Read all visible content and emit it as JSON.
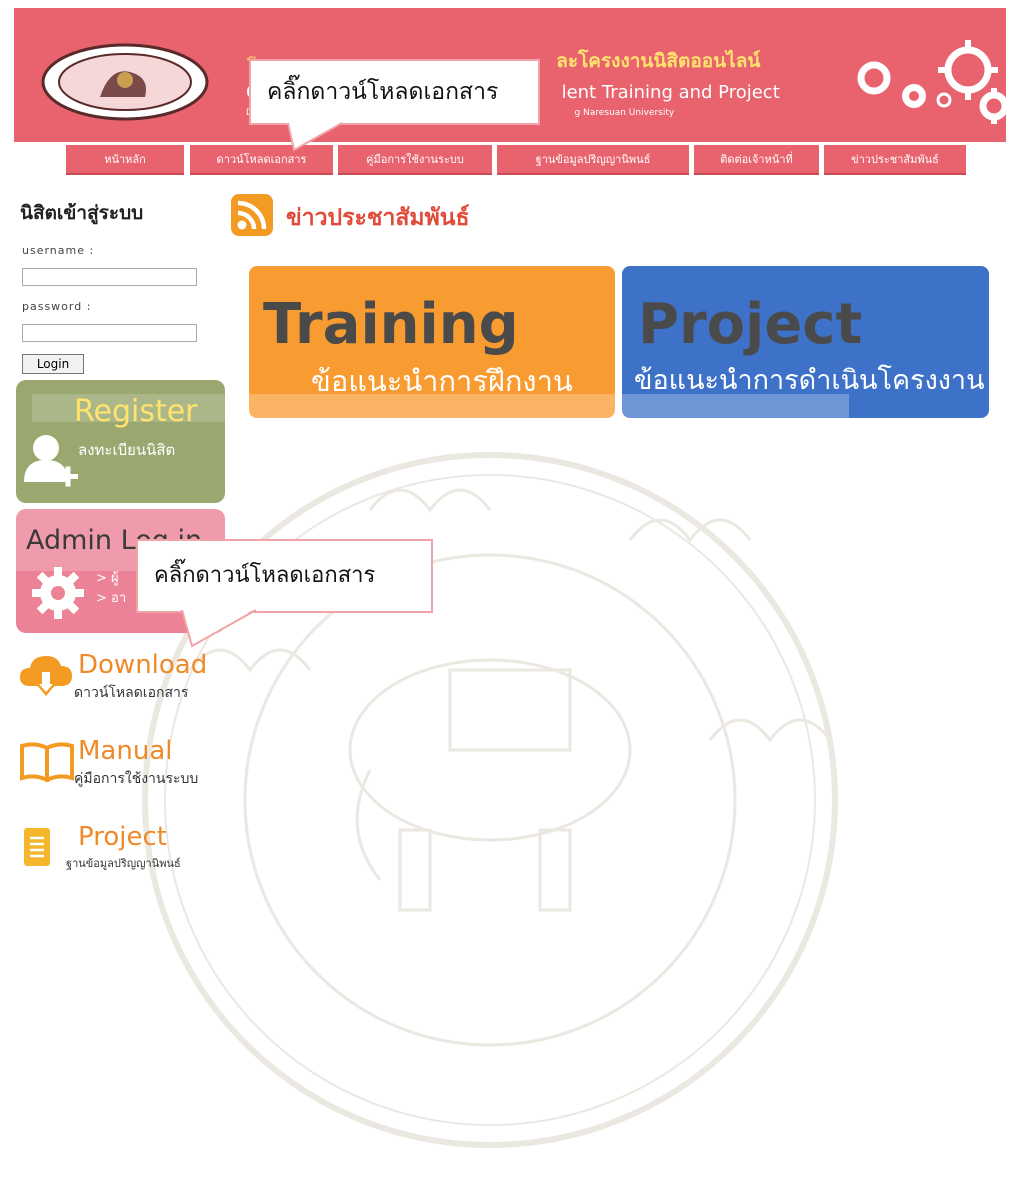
{
  "header": {
    "title_th": "ระบบฝึกงานและโครงงานนิสิตออนไลน์",
    "title_en_partial": "lent Training and Project",
    "title_sub": "g Naresuan University",
    "title_th_visible": "ละโครงงานนิสิตออนไลน์",
    "title_en_prefix": "C",
    "title_sub_prefix": "De"
  },
  "nav": {
    "items": [
      {
        "label": "หน้าหลัก"
      },
      {
        "label": "ดาวน์โหลดเอกสาร"
      },
      {
        "label": "คู่มือการใช้งานระบบ"
      },
      {
        "label": "ฐานข้อมูลปริญญานิพนธ์"
      },
      {
        "label": "ติดต่อเจ้าหน้าที่"
      },
      {
        "label": "ข่าวประชาสัมพันธ์"
      }
    ]
  },
  "callouts": {
    "top": "คลิ๊กดาวน์โหลดเอกสาร",
    "middle": "คลิ๊กดาวน์โหลดเอกสาร"
  },
  "login": {
    "title": "นิสิตเข้าสู่ระบบ",
    "username_label": "username :",
    "password_label": "password :",
    "username_value": "",
    "password_value": "",
    "button": "Login"
  },
  "register_card": {
    "title": "Register",
    "subtitle": "ลงทะเบียนนิสิต"
  },
  "admin_card": {
    "title": "Admin Log in",
    "line1": "> ผู้",
    "line2": "> อา"
  },
  "side_links": [
    {
      "title": "Download",
      "subtitle": "ดาวน์โหลดเอกสาร",
      "icon": "cloud-download-icon"
    },
    {
      "title": "Manual",
      "subtitle": "คู่มือการใช้งานระบบ",
      "icon": "book-icon"
    },
    {
      "title": "Project",
      "subtitle": "ฐานข้อมูลปริญญานิพนธ์",
      "icon": "notebook-icon"
    }
  ],
  "news": {
    "title": "ข่าวประชาสัมพันธ์",
    "icon": "rss-icon"
  },
  "tiles": {
    "training": {
      "title": "Training",
      "subtitle": "ข้อแนะนำการฝึกงาน"
    },
    "project": {
      "title": "Project",
      "subtitle": "ข้อแนะนำการดำเนินโครงงาน"
    }
  },
  "colors": {
    "header_bg": "#e8636d",
    "nav_bg": "#e8636d",
    "title_yellow": "#ffe36e",
    "register_green": "#9aa870",
    "admin_pink": "#ec8296",
    "training_orange": "#f89b30",
    "project_blue": "#3e72c9",
    "accent_orange": "#ef8a2a",
    "news_red": "#e14b3a"
  }
}
